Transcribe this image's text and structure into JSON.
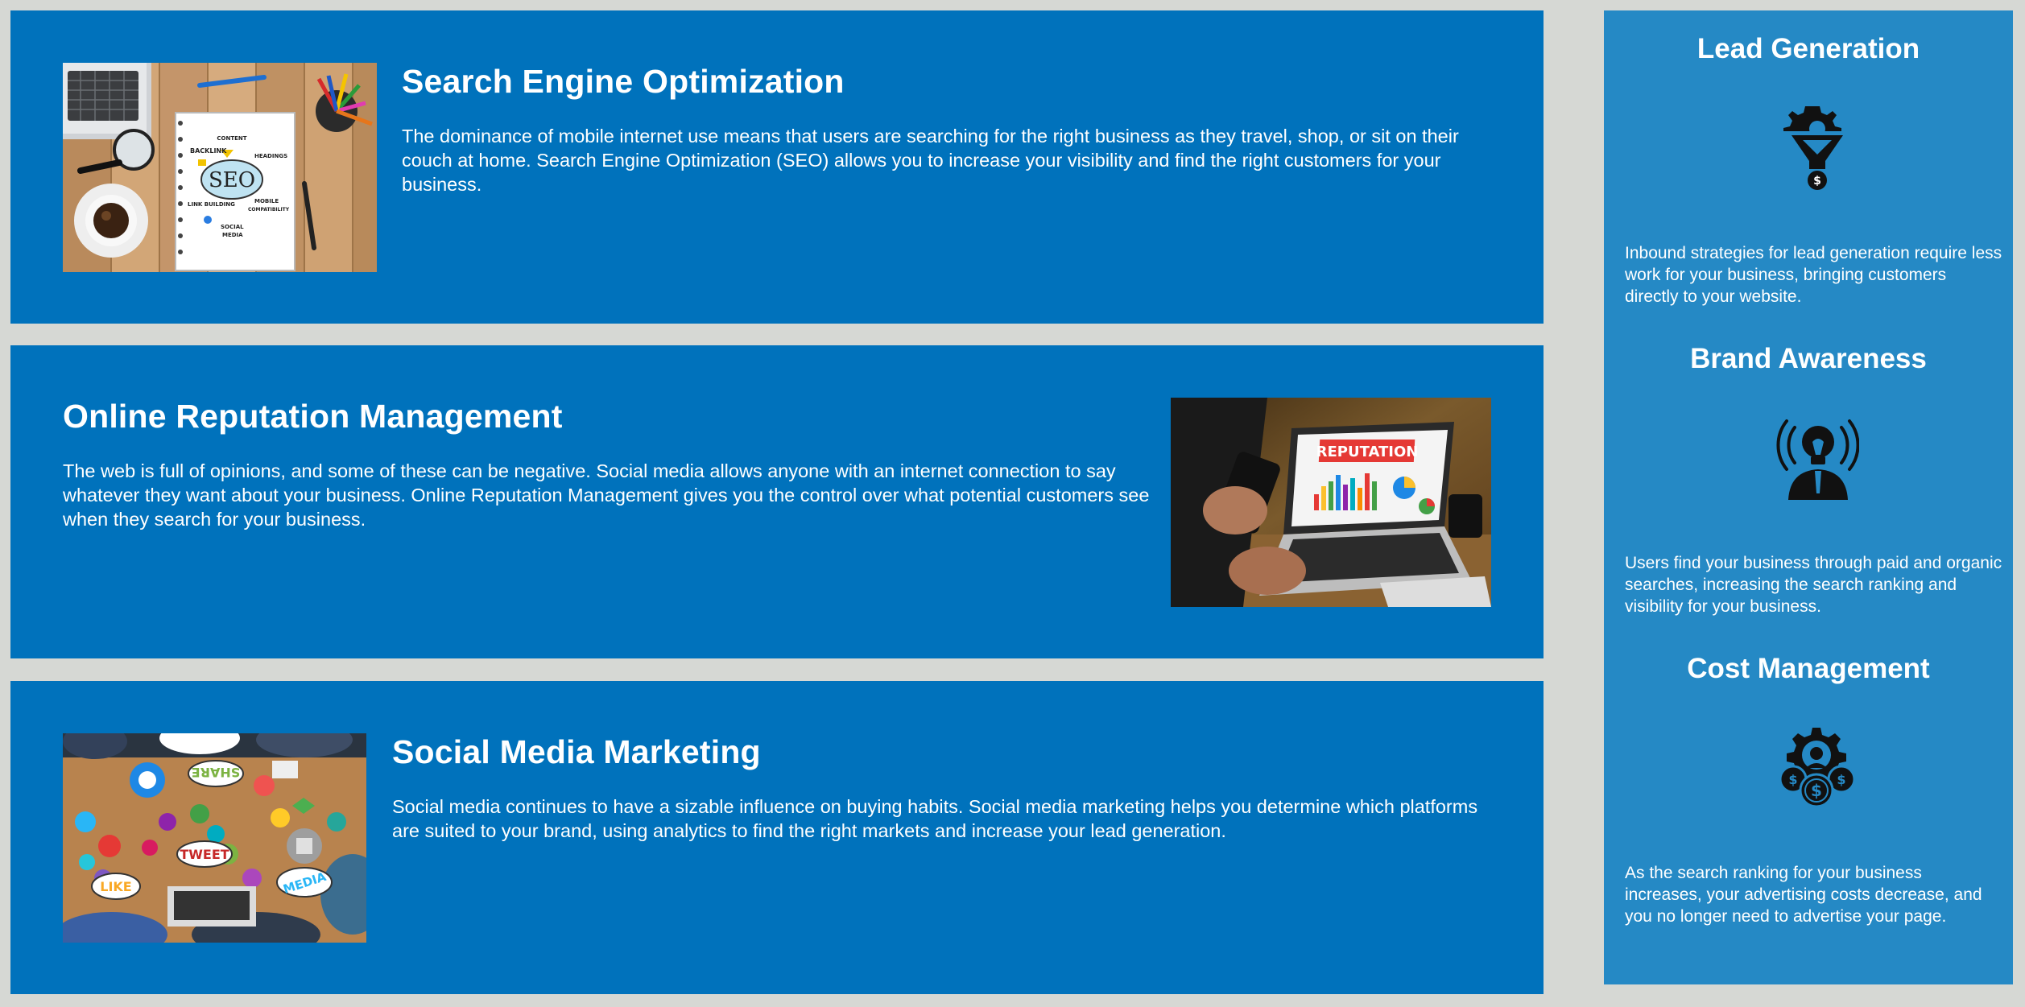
{
  "services": [
    {
      "title": "Search Engine Optimization",
      "text": "The dominance of mobile internet use means that users are searching for the right business as they travel, shop, or sit on their couch at home. Search Engine Optimization (SEO) allows you to increase your visibility and find the right customers for your business.",
      "image_labels": {
        "seo": "SEO",
        "content": "CONTENT",
        "backlink": "BACKLINK",
        "headings": "HEADINGS",
        "link_building": "LINK BUILDING",
        "mobile": "MOBILE",
        "compatibility": "COMPATIBILITY",
        "social": "SOCIAL",
        "media": "MEDIA"
      }
    },
    {
      "title": "Online Reputation Management",
      "text": "The web is full of opinions, and some of these can be negative. Social media allows anyone with an internet connection to say whatever they want about your business. Online Reputation Management gives you the control over what potential customers see when they search for your business.",
      "image_labels": {
        "banner": "REPUTATION"
      }
    },
    {
      "title": "Social Media Marketing",
      "text": "Social media continues to have a sizable influence on buying habits. Social media marketing helps you determine which platforms are suited to your brand, using analytics to find the right markets and increase your lead generation.",
      "image_labels": {
        "share": "SHARE",
        "tweet": "TWEET",
        "like": "LIKE",
        "media": "MEDIA"
      }
    }
  ],
  "sidebar": [
    {
      "title": "Lead Generation",
      "icon": "funnel-dollar-icon",
      "text": "Inbound strategies for lead generation require less work for your business, bringing customers directly to your website."
    },
    {
      "title": "Brand Awareness",
      "icon": "lightbulb-person-icon",
      "text": "Users find your business through paid and organic searches, increasing the search ranking and visibility for your business."
    },
    {
      "title": "Cost Management",
      "icon": "gear-coins-icon",
      "text": "As the search ranking for your business increases, your advertising costs decrease, and you no longer need to advertise your page."
    }
  ],
  "colors": {
    "page_background": "#d6d8d4",
    "card_background": "#0072bc",
    "sidebar_background": "#2589c5",
    "text": "#ffffff"
  }
}
